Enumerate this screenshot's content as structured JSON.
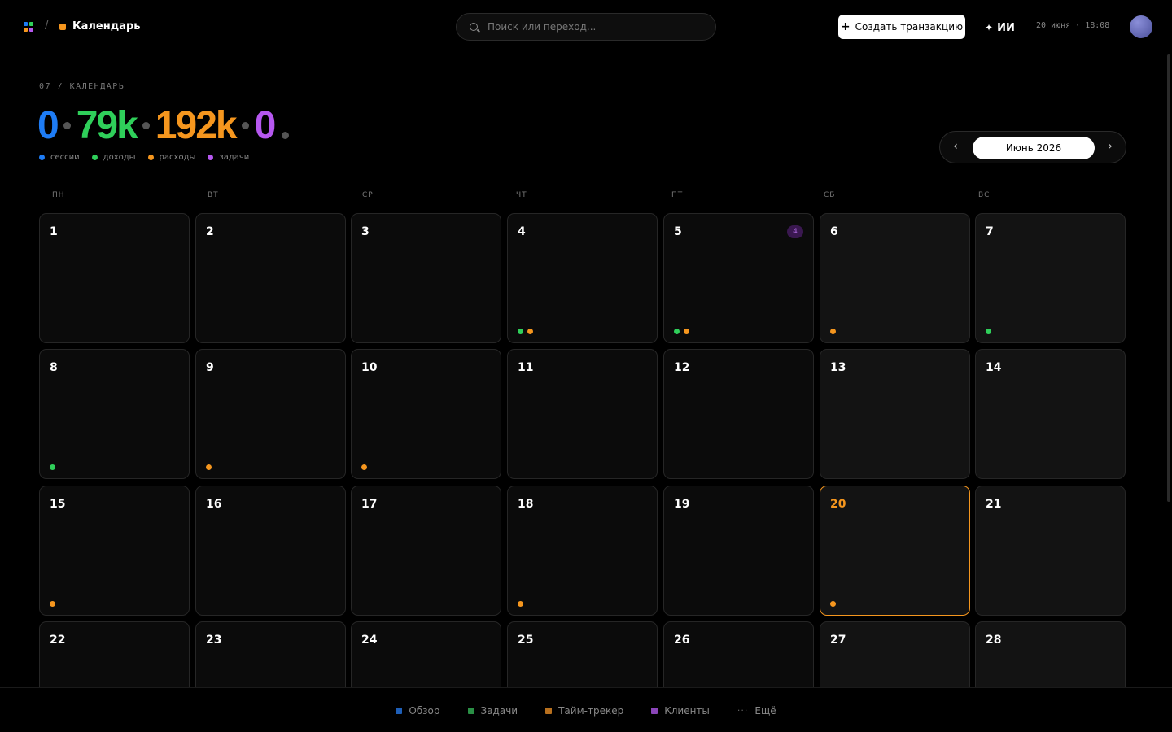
{
  "topbar": {
    "crumb_separator": "/",
    "crumb_title": "Календарь",
    "search_placeholder": "Поиск или переход...",
    "create_button_label": "Создать транзакцию",
    "create_button_icon": "+",
    "ai_button_icon": "✦",
    "ai_button_label": "ИИ",
    "datetime": "20 июня · 18:08",
    "app_grid_colors": [
      "#1e7cf5",
      "#2fcf5a",
      "#f5961e",
      "#b658f0"
    ],
    "crumb_dot_color": "#f5961e"
  },
  "header": {
    "section_crumb": "07 / КАЛЕНДАРЬ",
    "stats": [
      {
        "value": "0",
        "color": "#1e7cf5"
      },
      {
        "value": "79k",
        "color": "#2fcf5a"
      },
      {
        "value": "192k",
        "color": "#f5961e"
      },
      {
        "value": "0",
        "color": "#b658f0"
      }
    ],
    "legend": [
      {
        "label": "сессии",
        "color": "#1e7cf5"
      },
      {
        "label": "доходы",
        "color": "#2fcf5a"
      },
      {
        "label": "расходы",
        "color": "#f5961e"
      },
      {
        "label": "задачи",
        "color": "#b658f0"
      }
    ]
  },
  "month_nav": {
    "prev_icon": "‹",
    "label": "Июнь 2026",
    "next_icon": "›"
  },
  "calendar": {
    "weekdays": [
      "ПН",
      "ВТ",
      "СР",
      "ЧТ",
      "ПТ",
      "СБ",
      "ВС"
    ],
    "today": "20",
    "colors": {
      "green": "#2fcf5a",
      "orange": "#f5961e"
    },
    "weeks": [
      [
        {
          "day": "1",
          "dots": []
        },
        {
          "day": "2",
          "dots": []
        },
        {
          "day": "3",
          "dots": []
        },
        {
          "day": "4",
          "dots": [
            "green",
            "orange"
          ]
        },
        {
          "day": "5",
          "dots": [
            "green",
            "orange"
          ],
          "badge": "4"
        },
        {
          "day": "6",
          "dots": [
            "orange"
          ]
        },
        {
          "day": "7",
          "dots": [
            "green"
          ]
        }
      ],
      [
        {
          "day": "8",
          "dots": [
            "green"
          ]
        },
        {
          "day": "9",
          "dots": [
            "orange"
          ]
        },
        {
          "day": "10",
          "dots": [
            "orange"
          ]
        },
        {
          "day": "11",
          "dots": []
        },
        {
          "day": "12",
          "dots": []
        },
        {
          "day": "13",
          "dots": []
        },
        {
          "day": "14",
          "dots": []
        }
      ],
      [
        {
          "day": "15",
          "dots": [
            "orange"
          ]
        },
        {
          "day": "16",
          "dots": []
        },
        {
          "day": "17",
          "dots": []
        },
        {
          "day": "18",
          "dots": [
            "orange"
          ]
        },
        {
          "day": "19",
          "dots": []
        },
        {
          "day": "20",
          "dots": [
            "orange"
          ]
        },
        {
          "day": "21",
          "dots": []
        }
      ],
      [
        {
          "day": "22",
          "dots": []
        },
        {
          "day": "23",
          "dots": []
        },
        {
          "day": "24",
          "dots": []
        },
        {
          "day": "25",
          "dots": []
        },
        {
          "day": "26",
          "dots": []
        },
        {
          "day": "27",
          "dots": []
        },
        {
          "day": "28",
          "dots": []
        }
      ]
    ]
  },
  "bottom_nav": {
    "items": [
      {
        "label": "Обзор",
        "color": "#1e5fb8"
      },
      {
        "label": "Задачи",
        "color": "#2a8f45"
      },
      {
        "label": "Тайм-трекер",
        "color": "#b8701e"
      },
      {
        "label": "Клиенты",
        "color": "#8a45b8"
      }
    ],
    "more_icon": "···",
    "more_label": "Ещё"
  }
}
